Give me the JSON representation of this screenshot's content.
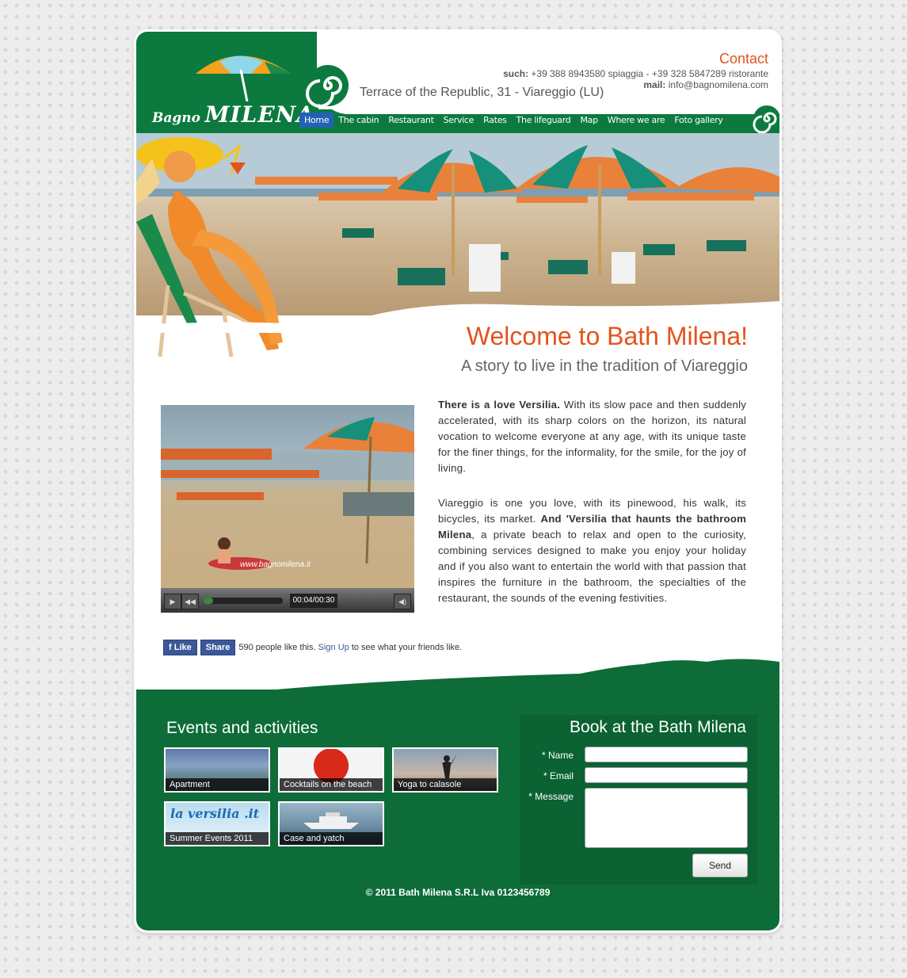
{
  "brand": {
    "logo_small": "Bagno",
    "logo_big": "MILENA"
  },
  "contact": {
    "title": "Contact",
    "phone_label": "such:",
    "phone_text": "+39 388 8943580 spiaggia - +39 328 5847289 ristorante",
    "mail_label": "mail:",
    "mail_text": "info@bagnomilena.com",
    "address": "Terrace of the Republic, 31 - Viareggio (LU)"
  },
  "nav": [
    {
      "label": "Home"
    },
    {
      "label": "The cabin"
    },
    {
      "label": "Restaurant"
    },
    {
      "label": "Service"
    },
    {
      "label": "Rates"
    },
    {
      "label": "The lifeguard"
    },
    {
      "label": "Map"
    },
    {
      "label": "Where we are"
    },
    {
      "label": "Foto gallery"
    }
  ],
  "welcome": {
    "title": "Welcome to Bath Milena!",
    "subtitle": "A story to live in the tradition of Viareggio"
  },
  "video": {
    "time": "00:04/00:30",
    "watermark": "www.bagnomilena.it",
    "progress": 0.12
  },
  "intro": {
    "p1_bold": "There is a love Versilia.",
    "p1_text": " With its slow pace and then suddenly accelerated, with its sharp colors on the horizon, its natural vocation to welcome everyone at any age, with its unique taste for the finer things, for the informality, for the smile, for the joy of living.",
    "p2_a": "Viareggio is one you love, with its pinewood, his walk, its bicycles, its market. ",
    "p2_bold": "And 'Versilia that haunts the bathroom Milena",
    "p2_b": ", a private beach to relax and open to the curiosity, combining services designed to make you enjoy your holiday and if you also want to entertain the world with that passion that inspires the furniture in the bathroom, the specialties of the restaurant, the sounds of the evening festivities."
  },
  "facebook": {
    "like": "Like",
    "share": "Share",
    "count_text": "590 people like this.",
    "signup": "Sign Up",
    "after": "to see what your friends like."
  },
  "events": {
    "title": "Events and activities",
    "items": [
      {
        "caption": "Apartment"
      },
      {
        "caption": "Cocktails on the beach"
      },
      {
        "caption": "Yoga to calasole"
      },
      {
        "caption": "Summer Events 2011",
        "logo": "la versilia .it"
      },
      {
        "caption": "Case and yatch"
      }
    ]
  },
  "booking": {
    "title": "Book at the Bath Milena",
    "name_label": "* Name",
    "email_label": "* Email",
    "message_label": "* Message",
    "send": "Send"
  },
  "footer": {
    "copyright": "© 2011 Bath Milena S.R.L Iva 0123456789"
  },
  "colors": {
    "green": "#0c7a3e",
    "orange": "#e2541d",
    "nav_active": "#2361b3"
  }
}
